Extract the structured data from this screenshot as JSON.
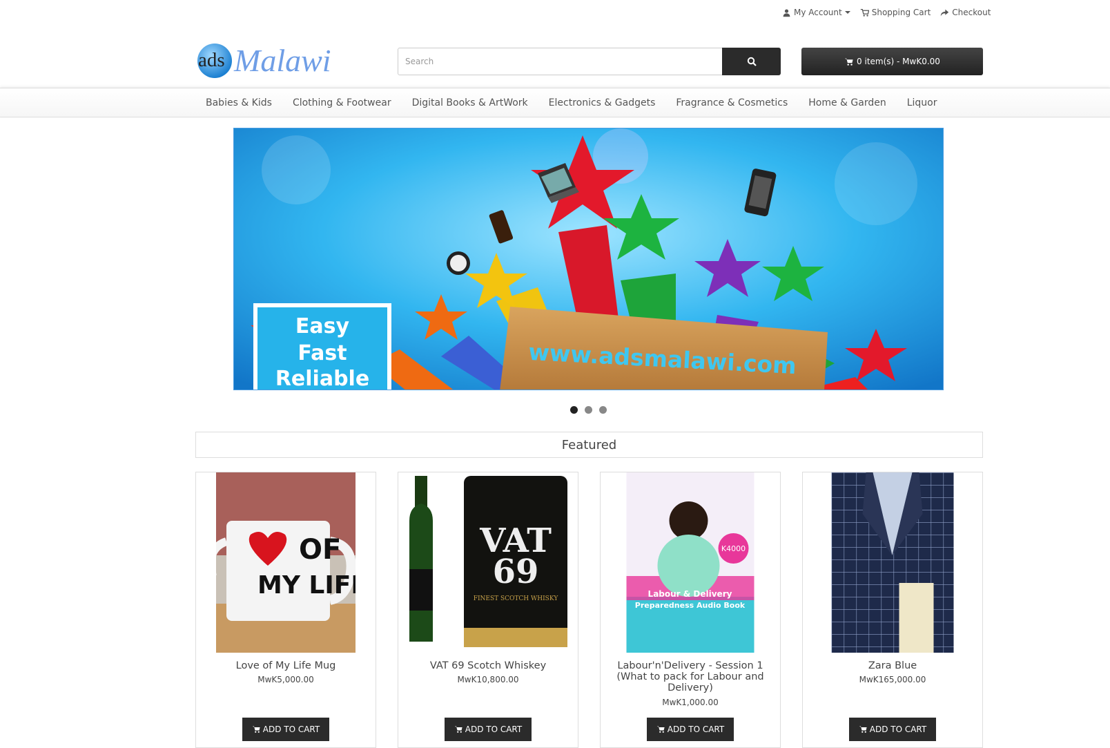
{
  "top_links": {
    "account": "My Account",
    "cart": "Shopping Cart",
    "checkout": "Checkout"
  },
  "logo": {
    "prefix": "ads",
    "name": "Malawi"
  },
  "search": {
    "placeholder": "Search",
    "value": ""
  },
  "cart_summary": "0 item(s) - MwK0.00",
  "nav": {
    "items": [
      "Babies & Kids",
      "Clothing & Footwear",
      "Digital Books & ArtWork",
      "Electronics & Gadgets",
      "Fragrance & Cosmetics",
      "Home & Garden",
      "Liquor"
    ]
  },
  "banner": {
    "tagline_1": "Easy",
    "tagline_2": "Fast",
    "tagline_3": "Reliable",
    "url": "www.adsmalawi.com",
    "active_slide": 1,
    "slide_count": 3
  },
  "featured_title": "Featured",
  "products": [
    {
      "name": "Love of My Life Mug",
      "price": "MwK5,000.00",
      "button": "ADD TO CART",
      "img_text_1": "OF",
      "img_text_2": "MY LIFE"
    },
    {
      "name": "VAT 69 Scotch Whiskey",
      "price": "MwK10,800.00",
      "button": "ADD TO CART",
      "img_text_1": "VAT",
      "img_text_2": "69",
      "img_text_3": "FINEST SCOTCH WHISKY"
    },
    {
      "name": "Labour'n'Delivery - Session 1 (What to pack for Labour and Delivery)",
      "price": "MwK1,000.00",
      "button": "ADD TO CART",
      "img_text_1": "K4000",
      "img_text_2": "Labour & Delivery",
      "img_text_3": "Preparedness Audio Book"
    },
    {
      "name": "Zara Blue",
      "price": "MwK165,000.00",
      "button": "ADD TO CART"
    }
  ],
  "colors": {
    "dark_button": "#2b2b2b",
    "logo_blue": "#5a8fd8",
    "banner_sky": "#2aa6e8"
  }
}
